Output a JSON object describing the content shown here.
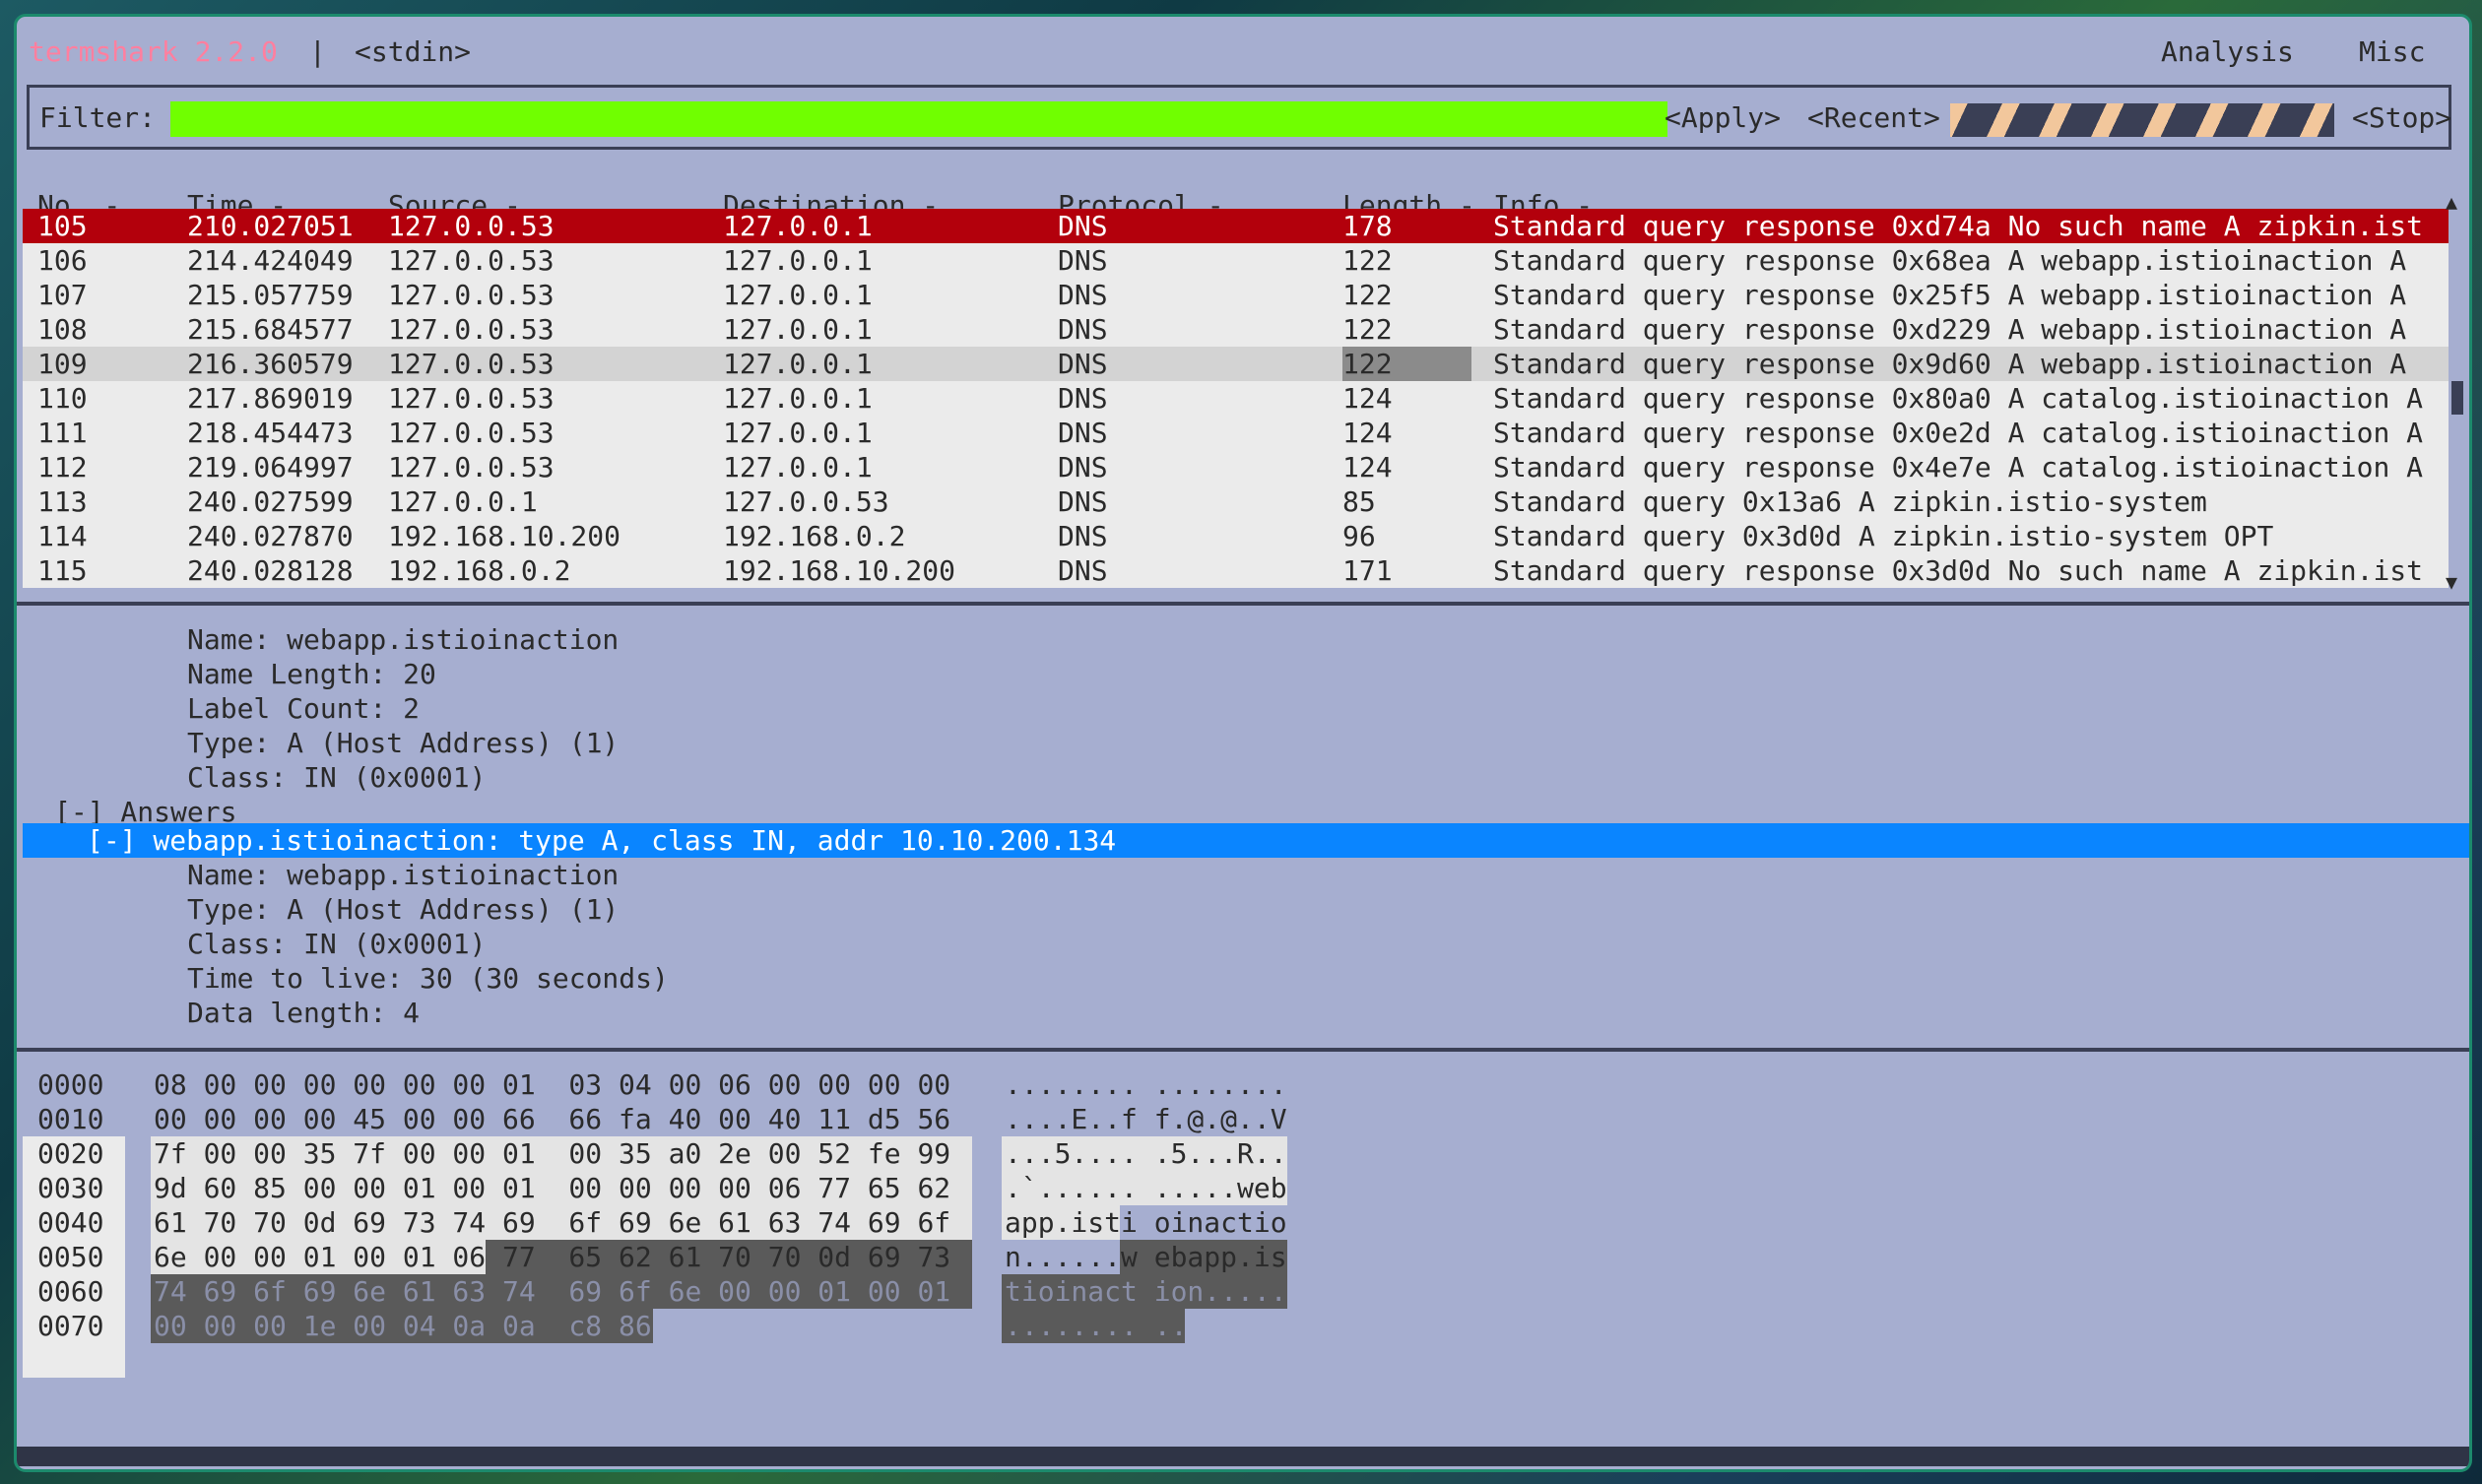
{
  "title": {
    "app": "termshark 2.2.0",
    "separator": "|",
    "source": "<stdin>"
  },
  "menu": [
    {
      "label": "Analysis"
    },
    {
      "label": "Misc"
    }
  ],
  "filter": {
    "label": "Filter:",
    "value": "",
    "apply": "<Apply>",
    "recent": "<Recent>",
    "stop": "<Stop>"
  },
  "packet_list": {
    "columns": [
      {
        "label": "No. -"
      },
      {
        "label": "Time -"
      },
      {
        "label": "Source -"
      },
      {
        "label": "Destination -"
      },
      {
        "label": "Protocol -"
      },
      {
        "label": "Length -"
      },
      {
        "label": "Info -"
      }
    ],
    "rows": [
      {
        "no": "105",
        "time": "210.027051",
        "src": "127.0.0.53",
        "dst": "127.0.0.1",
        "proto": "DNS",
        "len": "178",
        "info": "Standard query response 0xd74a No such name A zipkin.ist"
      },
      {
        "no": "106",
        "time": "214.424049",
        "src": "127.0.0.53",
        "dst": "127.0.0.1",
        "proto": "DNS",
        "len": "122",
        "info": "Standard query response 0x68ea A webapp.istioinaction A"
      },
      {
        "no": "107",
        "time": "215.057759",
        "src": "127.0.0.53",
        "dst": "127.0.0.1",
        "proto": "DNS",
        "len": "122",
        "info": "Standard query response 0x25f5 A webapp.istioinaction A"
      },
      {
        "no": "108",
        "time": "215.684577",
        "src": "127.0.0.53",
        "dst": "127.0.0.1",
        "proto": "DNS",
        "len": "122",
        "info": "Standard query response 0xd229 A webapp.istioinaction A"
      },
      {
        "no": "109",
        "time": "216.360579",
        "src": "127.0.0.53",
        "dst": "127.0.0.1",
        "proto": "DNS",
        "len": "122",
        "info": "Standard query response 0x9d60 A webapp.istioinaction A"
      },
      {
        "no": "110",
        "time": "217.869019",
        "src": "127.0.0.53",
        "dst": "127.0.0.1",
        "proto": "DNS",
        "len": "124",
        "info": "Standard query response 0x80a0 A catalog.istioinaction A"
      },
      {
        "no": "111",
        "time": "218.454473",
        "src": "127.0.0.53",
        "dst": "127.0.0.1",
        "proto": "DNS",
        "len": "124",
        "info": "Standard query response 0x0e2d A catalog.istioinaction A"
      },
      {
        "no": "112",
        "time": "219.064997",
        "src": "127.0.0.53",
        "dst": "127.0.0.1",
        "proto": "DNS",
        "len": "124",
        "info": "Standard query response 0x4e7e A catalog.istioinaction A"
      },
      {
        "no": "113",
        "time": "240.027599",
        "src": "127.0.0.1",
        "dst": "127.0.0.53",
        "proto": "DNS",
        "len": "85",
        "info": "Standard query 0x13a6 A zipkin.istio-system"
      },
      {
        "no": "114",
        "time": "240.027870",
        "src": "192.168.10.200",
        "dst": "192.168.0.2",
        "proto": "DNS",
        "len": "96",
        "info": "Standard query 0x3d0d A zipkin.istio-system OPT"
      },
      {
        "no": "115",
        "time": "240.028128",
        "src": "192.168.0.2",
        "dst": "192.168.10.200",
        "proto": "DNS",
        "len": "171",
        "info": "Standard query response 0x3d0d No such name A zipkin.ist"
      }
    ]
  },
  "details": {
    "query_lines": [
      "Name: webapp.istioinaction",
      "Name Length: 20",
      "Label Count: 2",
      "Type: A (Host Address) (1)",
      "Class: IN (0x0001)"
    ],
    "answers_label": "[-] Answers",
    "answer_selected": "[-] webapp.istioinaction: type A, class IN, addr 10.10.200.134",
    "answer_lines": [
      "Name: webapp.istioinaction",
      "Type: A (Host Address) (1)",
      "Class: IN (0x0001)",
      "Time to live: 30 (30 seconds)",
      "Data length: 4"
    ]
  },
  "hexdump": [
    {
      "offset": "0000",
      "hex": "08 00 00 00 00 00 00 01  03 04 00 06 00 00 00 00",
      "ascii": "........ ........"
    },
    {
      "offset": "0010",
      "hex": "00 00 00 00 45 00 00 66  66 fa 40 00 40 11 d5 56",
      "ascii": "....E..f f.@.@..V"
    },
    {
      "offset": "0020",
      "hex": "7f 00 00 35 7f 00 00 01  00 35 a0 2e 00 52 fe 99",
      "ascii": "...5.... .5...R.."
    },
    {
      "offset": "0030",
      "hex": "9d 60 85 00 00 01 00 01  00 00 00 00 06 77 65 62",
      "ascii": ".`...... .....web"
    },
    {
      "offset": "0040",
      "hex": "61 70 70 0d 69 73 74 69  6f 69 6e 61 63 74 69 6f",
      "ascii": "app.isti oinactio"
    },
    {
      "offset": "0050",
      "hex": "6e 00 00 01 00 01 06 77  65 62 61 70 70 0d 69 73",
      "ascii": "n......w ebapp.is"
    },
    {
      "offset": "0060",
      "hex": "74 69 6f 69 6e 61 63 74  69 6f 6e 00 00 01 00 01",
      "ascii": "tioinact ion....."
    },
    {
      "offset": "0070",
      "hex": "00 00 00 1e 00 04 0a 0a  c8 86",
      "ascii": "........ .."
    }
  ],
  "colors": {
    "background": "#a6aed0",
    "selected_row": "#b3000c",
    "highlight_row": "#d3d3d3",
    "filter_valid": "#70ff00",
    "detail_selected": "#0a85ff",
    "app_title": "#ff7f9f"
  }
}
